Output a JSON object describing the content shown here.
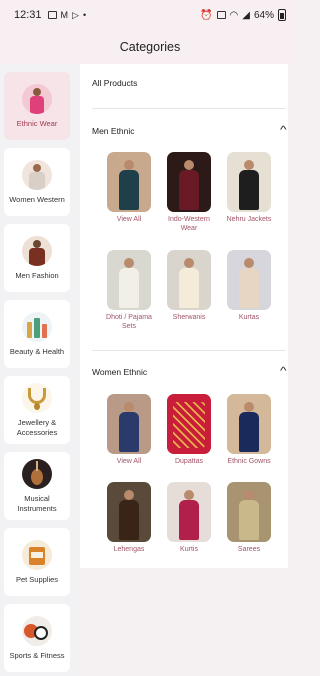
{
  "status_bar": {
    "time": "12:31",
    "battery": "64%"
  },
  "header": {
    "title": "Categories"
  },
  "sidebar": {
    "items": [
      {
        "label": "Ethnic Wear",
        "active": true
      },
      {
        "label": "Women Western",
        "active": false
      },
      {
        "label": "Men Fashion",
        "active": false
      },
      {
        "label": "Beauty & Health",
        "active": false
      },
      {
        "label": "Jewellery & Accessories",
        "active": false
      },
      {
        "label": "Musical Instruments",
        "active": false
      },
      {
        "label": "Pet Supplies",
        "active": false
      },
      {
        "label": "Sports & Fitness",
        "active": false
      }
    ]
  },
  "main": {
    "all_products": "All Products",
    "sections": [
      {
        "title": "Men Ethnic",
        "tiles": [
          {
            "label": "View All"
          },
          {
            "label": "Indo-Western Wear"
          },
          {
            "label": "Nehru Jackets"
          },
          {
            "label": "Dhoti / Pajama Sets"
          },
          {
            "label": "Sherwanis"
          },
          {
            "label": "Kurtas"
          }
        ]
      },
      {
        "title": "Women Ethnic",
        "tiles": [
          {
            "label": "View All"
          },
          {
            "label": "Dupattas"
          },
          {
            "label": "Ethnic Gowns"
          },
          {
            "label": "Lehengas"
          },
          {
            "label": "Kurtis"
          },
          {
            "label": "Sarees"
          }
        ]
      }
    ]
  },
  "colors": {
    "accent": "#a35466",
    "active_bg": "#f6e4e8",
    "header_bg": "#f7eff1"
  }
}
